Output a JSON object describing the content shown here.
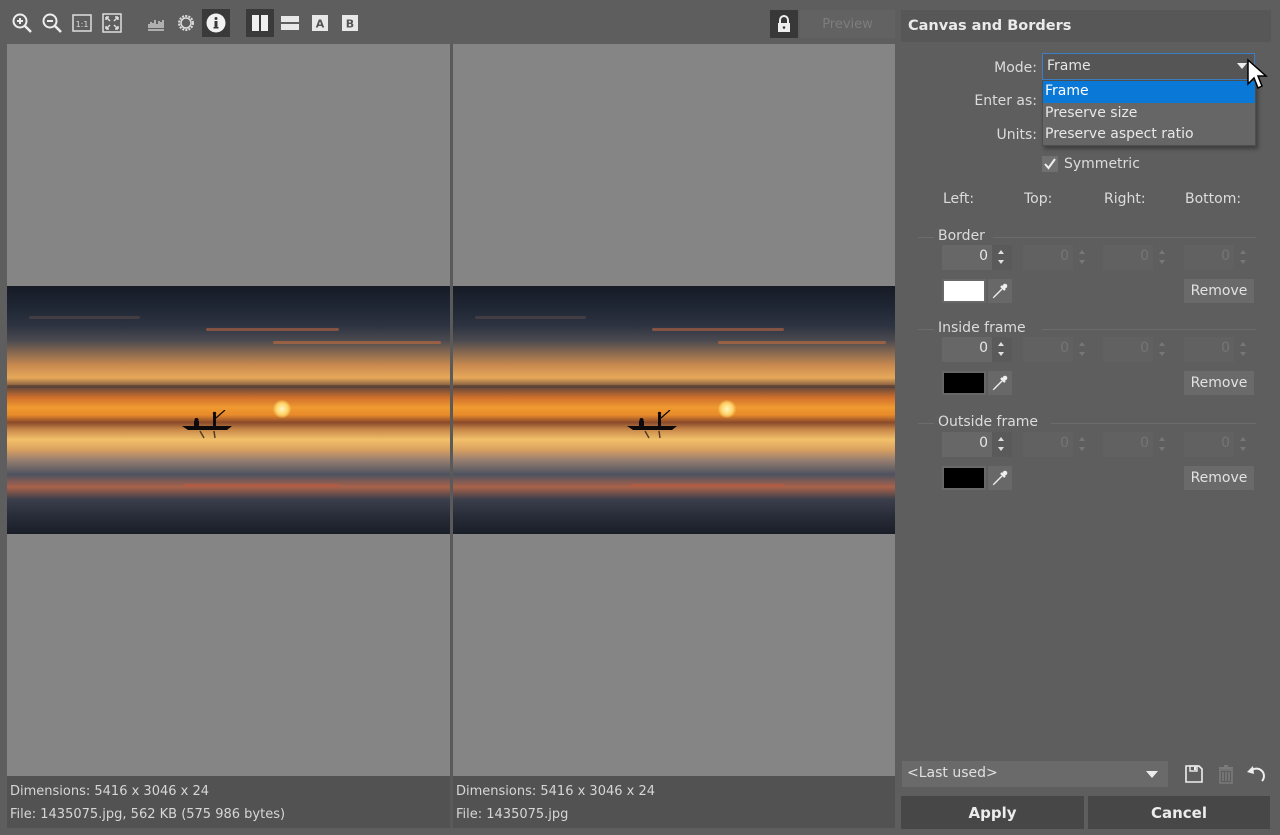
{
  "toolbar": {
    "buttons": [
      {
        "name": "zoom-in",
        "icon": "zoom-in-icon",
        "active": false
      },
      {
        "name": "zoom-out",
        "icon": "zoom-out-icon",
        "active": false
      },
      {
        "name": "actual-size",
        "icon": "one-to-one-icon",
        "label": "1:1",
        "active": false
      },
      {
        "name": "fit-to-window",
        "icon": "fit-screen-icon",
        "active": false
      },
      {
        "name": "histogram",
        "icon": "histogram-icon",
        "active": false
      },
      {
        "name": "exposure",
        "icon": "sun-icon",
        "active": false
      },
      {
        "name": "info",
        "icon": "info-icon",
        "active": true
      },
      {
        "name": "split-vertical",
        "icon": "split-vertical-icon",
        "active": true
      },
      {
        "name": "split-horizontal",
        "icon": "split-horizontal-icon",
        "active": false
      },
      {
        "name": "view-a",
        "icon": "a-icon",
        "label": "A",
        "active": false
      },
      {
        "name": "view-b",
        "icon": "b-icon",
        "label": "B",
        "active": false
      }
    ],
    "lock_icon": "lock-icon",
    "preview_label": "Preview"
  },
  "viewer": {
    "left": {
      "dimensions": "Dimensions: 5416 x 3046 x 24",
      "file": "File: 1435075.jpg, 562 KB (575 986 bytes)"
    },
    "right": {
      "dimensions": "Dimensions: 5416 x 3046 x 24",
      "file": "File: 1435075.jpg"
    }
  },
  "panel": {
    "title": "Canvas and Borders",
    "mode_label": "Mode:",
    "mode_value": "Frame",
    "mode_options": [
      "Frame",
      "Preserve size",
      "Preserve aspect ratio"
    ],
    "mode_selected_index": 0,
    "enter_as_label": "Enter as:",
    "units_label": "Units:",
    "symmetric_label": "Symmetric",
    "symmetric_checked": true,
    "columns": [
      "Left:",
      "Top:",
      "Right:",
      "Bottom:"
    ],
    "sections": [
      {
        "title": "Border",
        "values": [
          "0",
          "0",
          "0",
          "0"
        ],
        "color": "#ffffff",
        "remove_label": "Remove"
      },
      {
        "title": "Inside frame",
        "values": [
          "0",
          "0",
          "0",
          "0"
        ],
        "color": "#000000",
        "remove_label": "Remove"
      },
      {
        "title": "Outside frame",
        "values": [
          "0",
          "0",
          "0",
          "0"
        ],
        "color": "#000000",
        "remove_label": "Remove"
      }
    ],
    "preset_value": "<Last used>",
    "apply_label": "Apply",
    "cancel_label": "Cancel"
  },
  "colors": {
    "accent": "#0a78d7",
    "focus_border": "#3d7fc4"
  }
}
